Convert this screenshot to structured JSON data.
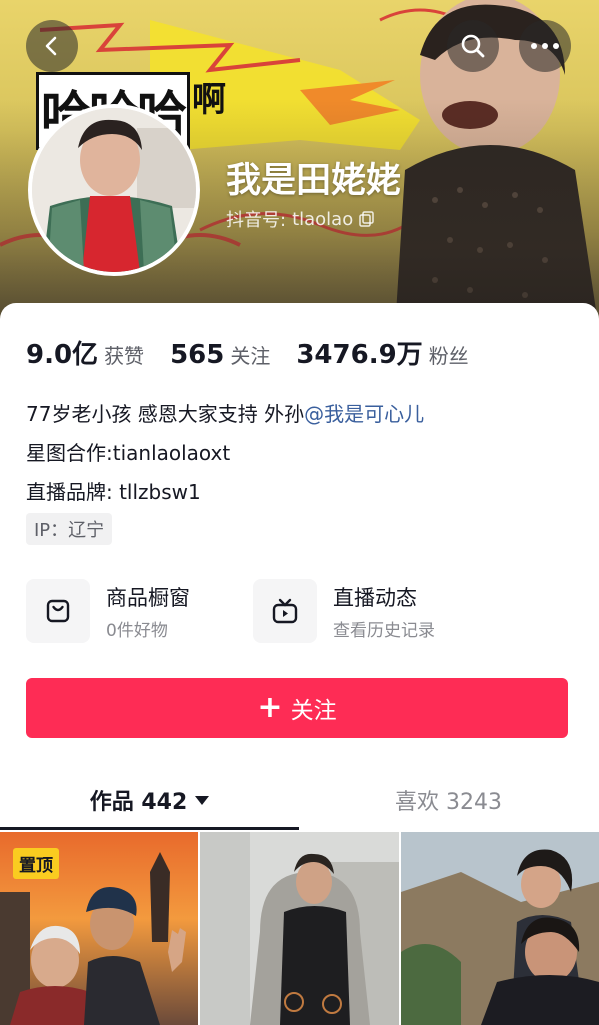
{
  "header": {
    "banner_text_big": "哈哈哈",
    "banner_text_small": "啊",
    "name": "我是田姥姥",
    "douyin_id_label": "抖音号:",
    "douyin_id": "tlaolao"
  },
  "stats": [
    {
      "value": "9.0亿",
      "label": "获赞"
    },
    {
      "value": "565",
      "label": "关注"
    },
    {
      "value": "3476.9万",
      "label": "粉丝"
    }
  ],
  "bio": {
    "line1_text": "77岁老小孩 感恩大家支持 外孙",
    "line1_mention": "@我是可心儿",
    "line2": "星图合作:tianlaolaoxt",
    "line3": "直播品牌: tllzbsw1",
    "ip": "IP：辽宁"
  },
  "entries": [
    {
      "title": "商品橱窗",
      "subtitle": "0件好物",
      "icon": "shopping-bag-icon"
    },
    {
      "title": "直播动态",
      "subtitle": "查看历史记录",
      "icon": "tv-icon"
    }
  ],
  "follow_button": {
    "label": "关注"
  },
  "tabs": [
    {
      "label": "作品 442",
      "active": true
    },
    {
      "label": "喜欢 3243",
      "active": false
    }
  ],
  "videos": [
    {
      "pinned_label": "置顶"
    },
    {},
    {}
  ],
  "colors": {
    "accent": "#fe2c55",
    "mention": "#3a5f9d",
    "pin_badge": "#facc20"
  }
}
